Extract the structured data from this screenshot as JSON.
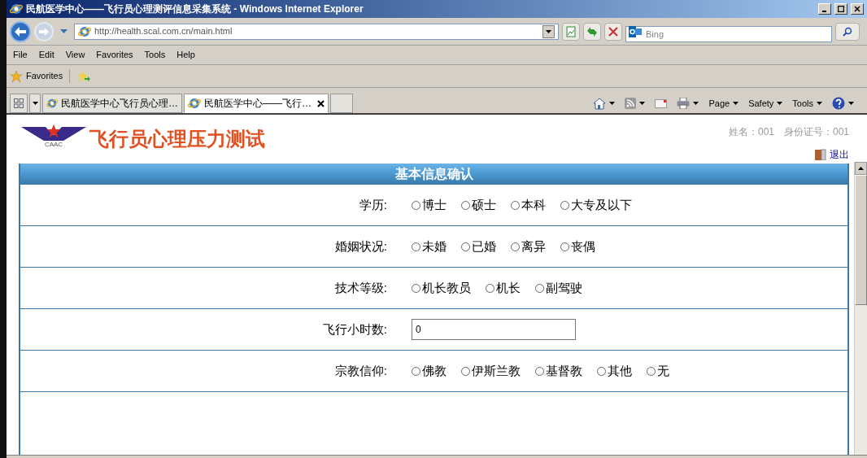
{
  "window": {
    "title": "民航医学中心——飞行员心理测评信息采集系统 - Windows Internet Explorer"
  },
  "address_bar": {
    "url": "http://health.scal.com.cn/main.html"
  },
  "search": {
    "placeholder": "Bing"
  },
  "menu": [
    "File",
    "Edit",
    "View",
    "Favorites",
    "Tools",
    "Help"
  ],
  "favorites_bar": {
    "label": "Favorites"
  },
  "tabs": [
    {
      "label": "民航医学中心飞行员心理…",
      "selected": false
    },
    {
      "label": "民航医学中心——飞行…",
      "selected": true
    }
  ],
  "command_bar": [
    "Page",
    "Safety",
    "Tools"
  ],
  "page": {
    "logo_text": "CAAC",
    "title": "飞行员心理压力测试",
    "user_info": "姓名：001　身份证号：001",
    "logout": "退出",
    "form_title": "基本信息确认",
    "fields": [
      {
        "kind": "radio",
        "label": "学历:",
        "options": [
          {
            "label": "博士",
            "selected": false
          },
          {
            "label": "硕士",
            "selected": false
          },
          {
            "label": "本科",
            "selected": false
          },
          {
            "label": "大专及以下",
            "selected": false
          }
        ]
      },
      {
        "kind": "radio",
        "label": "婚姻状况:",
        "options": [
          {
            "label": "未婚",
            "selected": false
          },
          {
            "label": "已婚",
            "selected": false
          },
          {
            "label": "离异",
            "selected": false
          },
          {
            "label": "丧偶",
            "selected": false
          }
        ]
      },
      {
        "kind": "radio",
        "label": "技术等级:",
        "options": [
          {
            "label": "机长教员",
            "selected": false
          },
          {
            "label": "机长",
            "selected": false
          },
          {
            "label": "副驾驶",
            "selected": false
          }
        ]
      },
      {
        "kind": "text",
        "label": "飞行小时数:",
        "value": "0"
      },
      {
        "kind": "radio",
        "label": "宗教信仰:",
        "options": [
          {
            "label": "佛教",
            "selected": false
          },
          {
            "label": "伊斯兰教",
            "selected": false
          },
          {
            "label": "基督教",
            "selected": false
          },
          {
            "label": "其他",
            "selected": false
          },
          {
            "label": "无",
            "selected": false
          }
        ]
      }
    ]
  }
}
